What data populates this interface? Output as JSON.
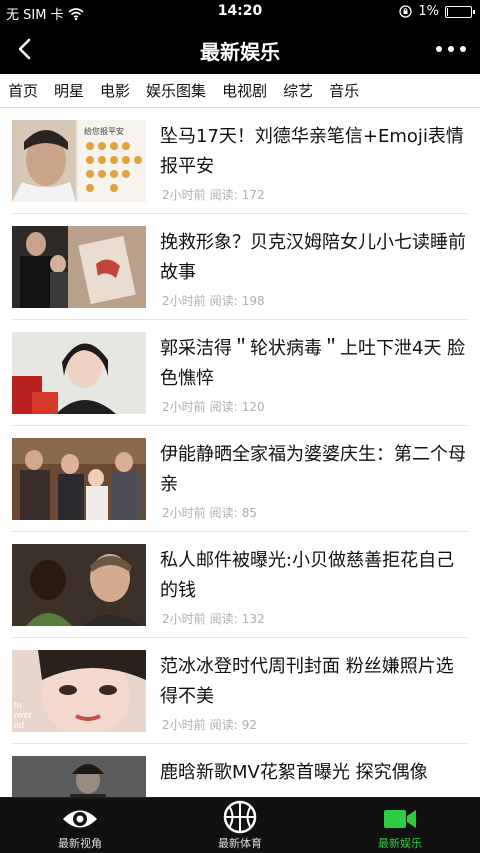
{
  "status_bar": {
    "carrier": "无 SIM 卡",
    "time": "14:20",
    "battery_text": "1%",
    "battery_level": 0.01,
    "icons": [
      "wifi-icon",
      "orientation-lock-icon",
      "battery-icon"
    ]
  },
  "nav": {
    "title": "最新娱乐",
    "back_icon": "chevron-left-icon",
    "more_icon": "more-dots-icon"
  },
  "tabs": [
    {
      "label": "首页",
      "active": true
    },
    {
      "label": "明星",
      "active": false
    },
    {
      "label": "电影",
      "active": false
    },
    {
      "label": "娱乐图集",
      "active": false
    },
    {
      "label": "电视剧",
      "active": false
    },
    {
      "label": "综艺",
      "active": false
    },
    {
      "label": "音乐",
      "active": false
    }
  ],
  "news": [
    {
      "title": "坠马17天！刘德华亲笔信+Emoji表情报平安",
      "time": "2小时前",
      "read_label": "阅读:",
      "reads": "172"
    },
    {
      "title": "挽救形象？贝克汉姆陪女儿小七读睡前故事",
      "time": "2小时前",
      "read_label": "阅读:",
      "reads": "198"
    },
    {
      "title": "郭采洁得＂轮状病毒＂上吐下泄4天 脸色憔悴",
      "time": "2小时前",
      "read_label": "阅读:",
      "reads": "120"
    },
    {
      "title": "伊能静晒全家福为婆婆庆生：第二个母亲",
      "time": "2小时前",
      "read_label": "阅读:",
      "reads": "85"
    },
    {
      "title": "私人邮件被曝光:小贝做慈善拒花自己的钱",
      "time": "2小时前",
      "read_label": "阅读:",
      "reads": "132"
    },
    {
      "title": "范冰冰登时代周刊封面 粉丝嫌照片选得不美",
      "time": "2小时前",
      "read_label": "阅读:",
      "reads": "92"
    },
    {
      "title": "鹿晗新歌MV花絮首曝光 探究偶像",
      "time": "",
      "read_label": "",
      "reads": ""
    }
  ],
  "thumb_text": {
    "letter_heading": "给您报平安",
    "cover_words": "to\nover\nnd"
  },
  "tab_bar": [
    {
      "label": "最新视角",
      "icon": "eye-icon",
      "active": false
    },
    {
      "label": "最新体育",
      "icon": "basketball-icon",
      "active": false
    },
    {
      "label": "最新娱乐",
      "icon": "video-camera-icon",
      "active": true
    }
  ],
  "colors": {
    "header_bg": "#000000",
    "active_green": "#2ecc40",
    "meta_gray": "#b0b0b0"
  }
}
